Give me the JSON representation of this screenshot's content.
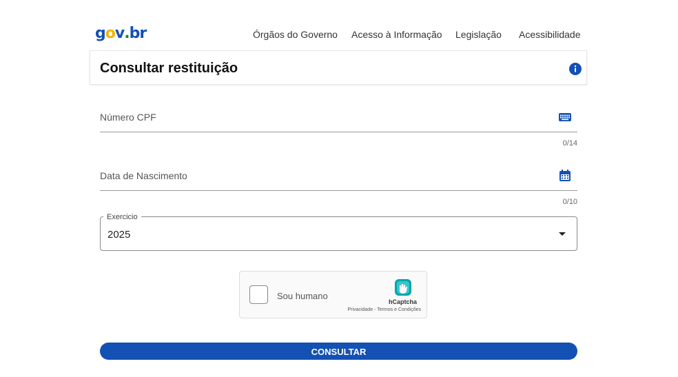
{
  "header": {
    "logo": {
      "g": "g",
      "o": "o",
      "v": "v",
      "dot": ".",
      "br": "br"
    },
    "nav": [
      "Órgãos do Governo",
      "Acesso à Informação",
      "Legislação",
      "Acessibilidade"
    ]
  },
  "page": {
    "title": "Consultar restituição"
  },
  "form": {
    "cpf": {
      "label": "Número CPF",
      "counter": "0/14",
      "value": ""
    },
    "birth": {
      "label": "Data de Nascimento",
      "counter": "0/10",
      "value": ""
    },
    "exercicio": {
      "legend": "Exercicio",
      "value": "2025"
    }
  },
  "captcha": {
    "label": "Sou humano",
    "brand": "hCaptcha",
    "links": "Privacidade - Termos e Condições"
  },
  "submit_label": "CONSULTAR",
  "colors": {
    "primary": "#1351b4",
    "logo_g": "#1351b4",
    "logo_o": "#f2b500",
    "logo_v": "#1351b4",
    "logo_dot": "#168821",
    "logo_br": "#1351b4"
  },
  "icons": {
    "info": "info-icon",
    "cpf": "keyboard-icon",
    "birth": "calendar-icon",
    "select": "caret-down-icon",
    "captcha": "hcaptcha-logo-icon"
  }
}
